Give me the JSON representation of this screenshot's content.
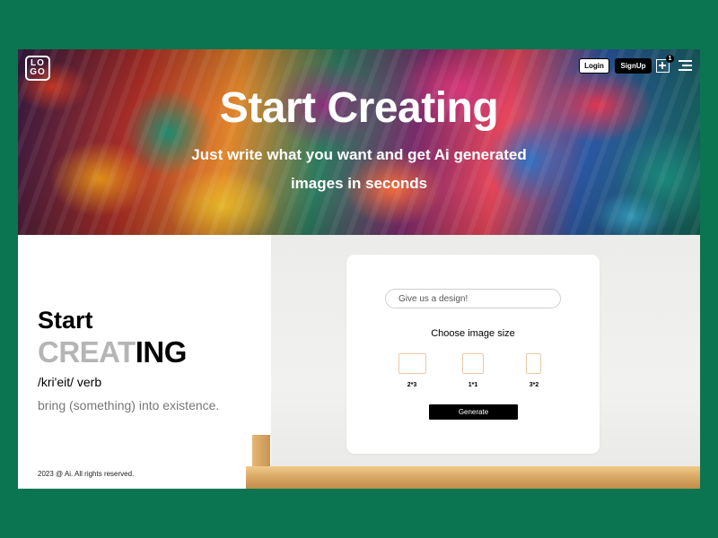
{
  "logo": {
    "line1": "LO",
    "line2": "GO"
  },
  "nav": {
    "login": "Login",
    "signup": "SignUp",
    "cart_count": "1"
  },
  "hero": {
    "title": "Start Creating",
    "subtitle": "Just write what you want and get Ai generated images in seconds"
  },
  "definition": {
    "word_start": "Start",
    "word_creat": "CREAT",
    "word_ing": "ING",
    "phonetic": "/kri'eit/ verb",
    "meaning": "bring (something) into existence."
  },
  "footer": {
    "copyright": "2023 @ Ai. All rights reserved."
  },
  "form": {
    "design_placeholder": "Give us a design!",
    "size_title": "Choose image size",
    "sizes": [
      "2*3",
      "1*1",
      "3*2"
    ],
    "generate_label": "Generate"
  },
  "colors": {
    "background": "#0a7550",
    "accent_border": "#e8c9a8"
  },
  "icons": [
    "add-image-icon",
    "menu-icon"
  ]
}
